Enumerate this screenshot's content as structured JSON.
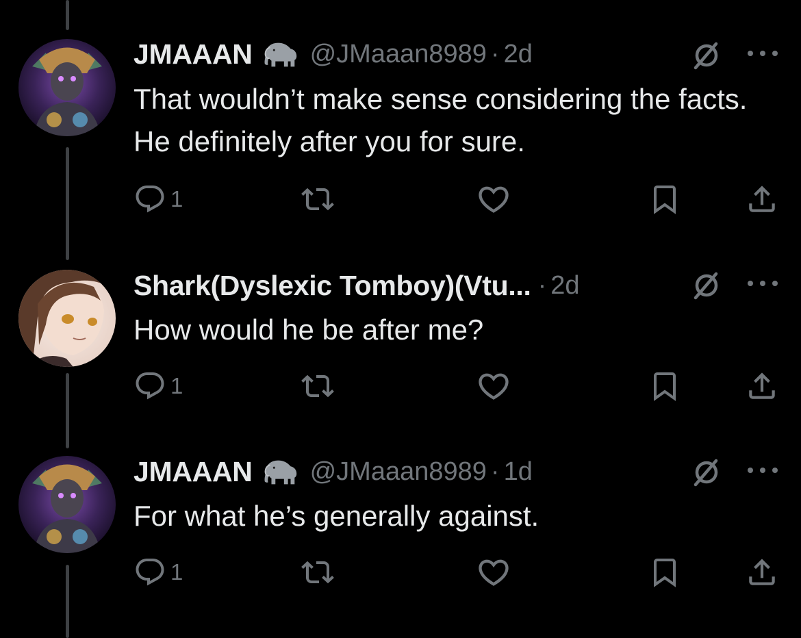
{
  "tweets": [
    {
      "display_name": "JMAAAN",
      "badge_icon": "elephant-emoji",
      "handle": "@JMaaan8989",
      "separator": "·",
      "time": "2d",
      "text": "That wouldn’t make sense considering the facts. He definitely after you for sure.",
      "reply_count": "1",
      "avatar": "cyber-warrior-avatar"
    },
    {
      "display_name": "Shark(Dyslexic Tomboy)(Vtu...",
      "handle": "",
      "separator": "·",
      "time": "2d",
      "text": "How would he be after me?",
      "reply_count": "1",
      "avatar": "anime-girl-avatar"
    },
    {
      "display_name": "JMAAAN",
      "badge_icon": "elephant-emoji",
      "handle": "@JMaaan8989",
      "separator": "·",
      "time": "1d",
      "text": "For what he’s generally against.",
      "reply_count": "1",
      "avatar": "cyber-warrior-avatar"
    }
  ],
  "icons": {
    "reply": "reply-icon",
    "retweet": "retweet-icon",
    "like": "like-icon",
    "bookmark": "bookmark-icon",
    "share": "share-icon",
    "grok": "grok-icon",
    "more": "more-icon"
  },
  "colors": {
    "background": "#000000",
    "primary_text": "#e7e9ea",
    "secondary_text": "#71767b",
    "thread_line": "#3e4144"
  }
}
